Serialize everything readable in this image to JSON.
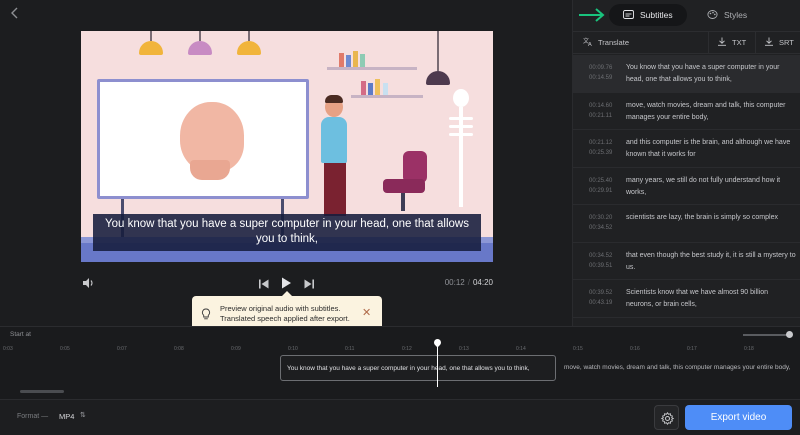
{
  "header": {
    "back_icon": "chevron-left-icon"
  },
  "video": {
    "caption": "You know that you have a super computer in your head, one that allows you to think,",
    "current_time": "00:12",
    "separator": "/",
    "duration": "04:20"
  },
  "tooltip": {
    "line1": "Preview original audio with subtitles.",
    "line2": "Translated speech applied after export.",
    "close": "✕"
  },
  "panel": {
    "tabs": [
      {
        "label": "Subtitles",
        "icon": "subtitles-icon",
        "active": true
      },
      {
        "label": "Styles",
        "icon": "palette-icon",
        "active": false
      }
    ],
    "tools": {
      "translate": "Translate",
      "txt": "TXT",
      "srt": "SRT"
    },
    "subtitles": [
      {
        "start": "00:09.76",
        "end": "00:14.59",
        "text": "You know that you have a super computer in your head, one that allows you to think,"
      },
      {
        "start": "00:14.60",
        "end": "00:21.11",
        "text": "move, watch movies, dream and talk, this computer manages your entire body,"
      },
      {
        "start": "00:21.12",
        "end": "00:25.39",
        "text": "and this computer is the brain, and although we have known that it works for"
      },
      {
        "start": "00:25.40",
        "end": "00:29.91",
        "text": "many years, we still do not fully understand how it works,"
      },
      {
        "start": "00:30.20",
        "end": "00:34.52",
        "text": "scientists are lazy, the brain is simply so complex"
      },
      {
        "start": "00:34.52",
        "end": "00:39.51",
        "text": "that even though the best study it, it is still a mystery to us."
      },
      {
        "start": "00:39.52",
        "end": "00:43.19",
        "text": "Scientists know that we have almost 90 billion neurons, or brain cells,"
      }
    ]
  },
  "timeline": {
    "start_at": "Start at",
    "ticks": [
      "0:03",
      "0:05",
      "0:07",
      "0:08",
      "0:09",
      "0:10",
      "0:11",
      "0:12",
      "0:13",
      "0:14",
      "0:15",
      "0:16",
      "0:17",
      "0:18"
    ],
    "clips": {
      "active": "You know that you have a super computer in your head, one that allows you to think,",
      "next": "move, watch movies, dream and talk, this computer manages your entire body,"
    }
  },
  "bottombar": {
    "format_label": "Format —",
    "format_value": "MP4",
    "format_caret": "⇅",
    "export_label": "Export video"
  },
  "colors": {
    "accent": "#4e8df7",
    "arrow": "#19c37d",
    "caption_bg": "#161c3c"
  }
}
